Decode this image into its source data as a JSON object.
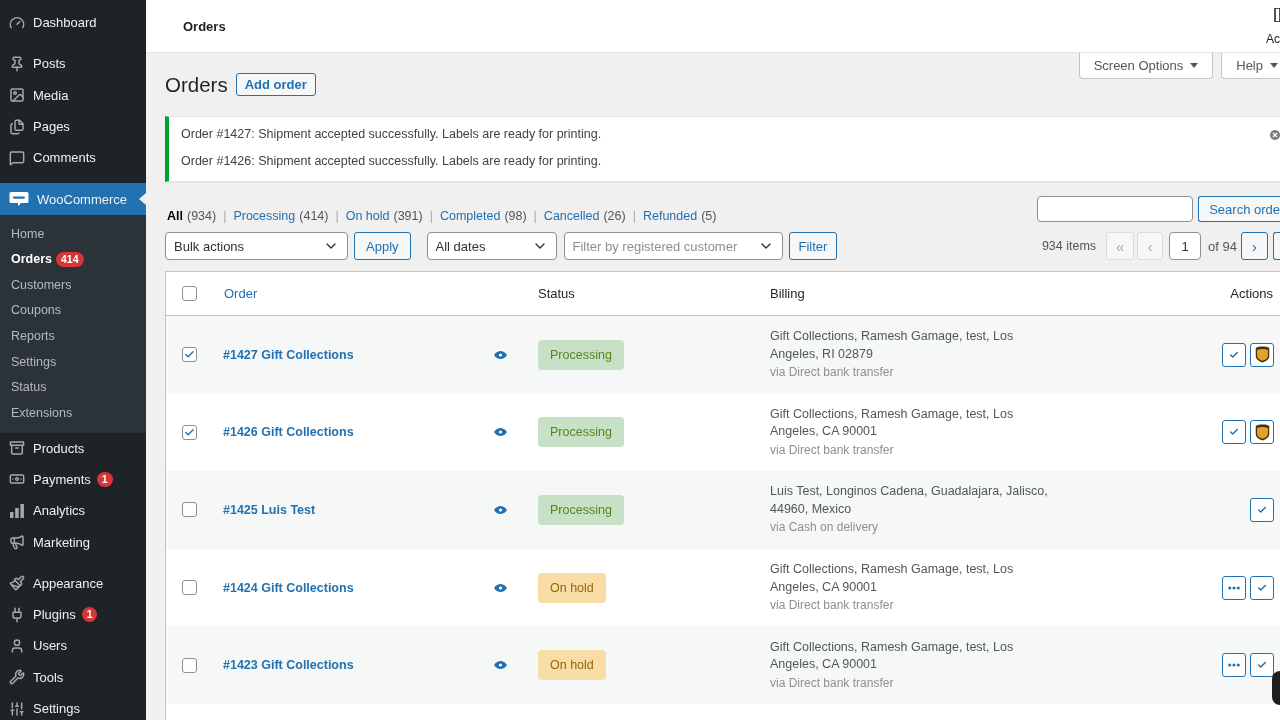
{
  "sidebar": {
    "groups": [
      {
        "items": [
          {
            "label": "Dashboard",
            "selected": false
          }
        ]
      },
      {
        "items": [
          {
            "label": "Posts",
            "selected": false
          },
          {
            "label": "Media",
            "selected": false
          },
          {
            "label": "Pages",
            "selected": false
          },
          {
            "label": "Comments",
            "selected": false
          }
        ]
      },
      {
        "items": [
          {
            "label": "WooCommerce",
            "selected": true,
            "children": [
              {
                "label": "Home",
                "selected": false
              },
              {
                "label": "Orders",
                "selected": true,
                "badge": "414"
              },
              {
                "label": "Customers",
                "selected": false
              },
              {
                "label": "Coupons",
                "selected": false
              },
              {
                "label": "Reports",
                "selected": false
              },
              {
                "label": "Settings",
                "selected": false
              },
              {
                "label": "Status",
                "selected": false
              },
              {
                "label": "Extensions",
                "selected": false
              }
            ]
          },
          {
            "label": "Products",
            "selected": false
          },
          {
            "label": "Payments",
            "selected": false,
            "badge": "1"
          },
          {
            "label": "Analytics",
            "selected": false
          },
          {
            "label": "Marketing",
            "selected": false
          }
        ]
      },
      {
        "items": [
          {
            "label": "Appearance",
            "selected": false
          },
          {
            "label": "Plugins",
            "selected": false,
            "badge": "1"
          },
          {
            "label": "Users",
            "selected": false
          },
          {
            "label": "Tools",
            "selected": false
          },
          {
            "label": "Settings",
            "selected": false
          }
        ]
      }
    ]
  },
  "header": {
    "title": "Orders",
    "activity_label": "Ac"
  },
  "screen_tabs": [
    {
      "label": "Screen Options"
    },
    {
      "label": "Help"
    }
  ],
  "page_title": "Orders",
  "add_button": "Add order",
  "notices": [
    "Order #1427: Shipment accepted successfully. Labels are ready for printing.",
    "Order #1426: Shipment accepted successfully. Labels are ready for printing."
  ],
  "views": {
    "separator": "|",
    "items": [
      {
        "label": "All",
        "count": "(934)",
        "selected": true
      },
      {
        "label": "Processing",
        "count": "(414)",
        "selected": false
      },
      {
        "label": "On hold",
        "count": "(391)",
        "selected": false
      },
      {
        "label": "Completed",
        "count": "(98)",
        "selected": false
      },
      {
        "label": "Cancelled",
        "count": "(26)",
        "selected": false
      },
      {
        "label": "Refunded",
        "count": "(5)",
        "selected": false
      }
    ]
  },
  "search": {
    "button": "Search orde"
  },
  "tablenav": {
    "bulk_select": "Bulk actions",
    "apply": "Apply",
    "date_select": "All dates",
    "customer_placeholder": "Filter by registered customer",
    "filter": "Filter"
  },
  "pagination": {
    "items_count": "934 items",
    "first": {
      "label": "«",
      "disabled": true
    },
    "prev": {
      "label": "‹",
      "disabled": true
    },
    "page": "1",
    "total": "of 94",
    "next": {
      "label": "›",
      "disabled": false
    },
    "last": {
      "disabled": false
    }
  },
  "table": {
    "select_all_checked": false,
    "columns": [
      {
        "label": "Order",
        "sortable": true
      },
      {
        "label": "Status",
        "sortable": false
      },
      {
        "label": "Billing",
        "sortable": false
      },
      {
        "label": "Actions",
        "sortable": false
      }
    ],
    "rows": [
      {
        "checked": true,
        "order": "#1427 Gift Collections",
        "status": {
          "label": "Processing",
          "kind": "processing"
        },
        "billing": "Gift Collections, Ramesh Gamage, test, Los Angeles, RI 02879",
        "payment": "via Direct bank transfer",
        "actions": [
          {
            "kind": "complete"
          },
          {
            "kind": "ups"
          }
        ]
      },
      {
        "checked": true,
        "order": "#1426 Gift Collections",
        "status": {
          "label": "Processing",
          "kind": "processing"
        },
        "billing": "Gift Collections, Ramesh Gamage, test, Los Angeles, CA 90001",
        "payment": "via Direct bank transfer",
        "actions": [
          {
            "kind": "complete"
          },
          {
            "kind": "ups"
          }
        ]
      },
      {
        "checked": false,
        "order": "#1425 Luis Test",
        "status": {
          "label": "Processing",
          "kind": "processing"
        },
        "billing": "Luis Test, Longinos Cadena, Guadalajara, Jalisco, 44960, Mexico",
        "payment": "via Cash on delivery",
        "actions": [
          {
            "kind": "complete"
          }
        ]
      },
      {
        "checked": false,
        "order": "#1424 Gift Collections",
        "status": {
          "label": "On hold",
          "kind": "on-hold"
        },
        "billing": "Gift Collections, Ramesh Gamage, test, Los Angeles, CA 90001",
        "payment": "via Direct bank transfer",
        "actions": [
          {
            "kind": "processing"
          },
          {
            "kind": "complete"
          }
        ]
      },
      {
        "checked": false,
        "order": "#1423 Gift Collections",
        "status": {
          "label": "On hold",
          "kind": "on-hold"
        },
        "billing": "Gift Collections, Ramesh Gamage, test, Los Angeles, CA 90001",
        "payment": "via Direct bank transfer",
        "actions": [
          {
            "kind": "processing"
          },
          {
            "kind": "complete"
          }
        ]
      }
    ]
  }
}
